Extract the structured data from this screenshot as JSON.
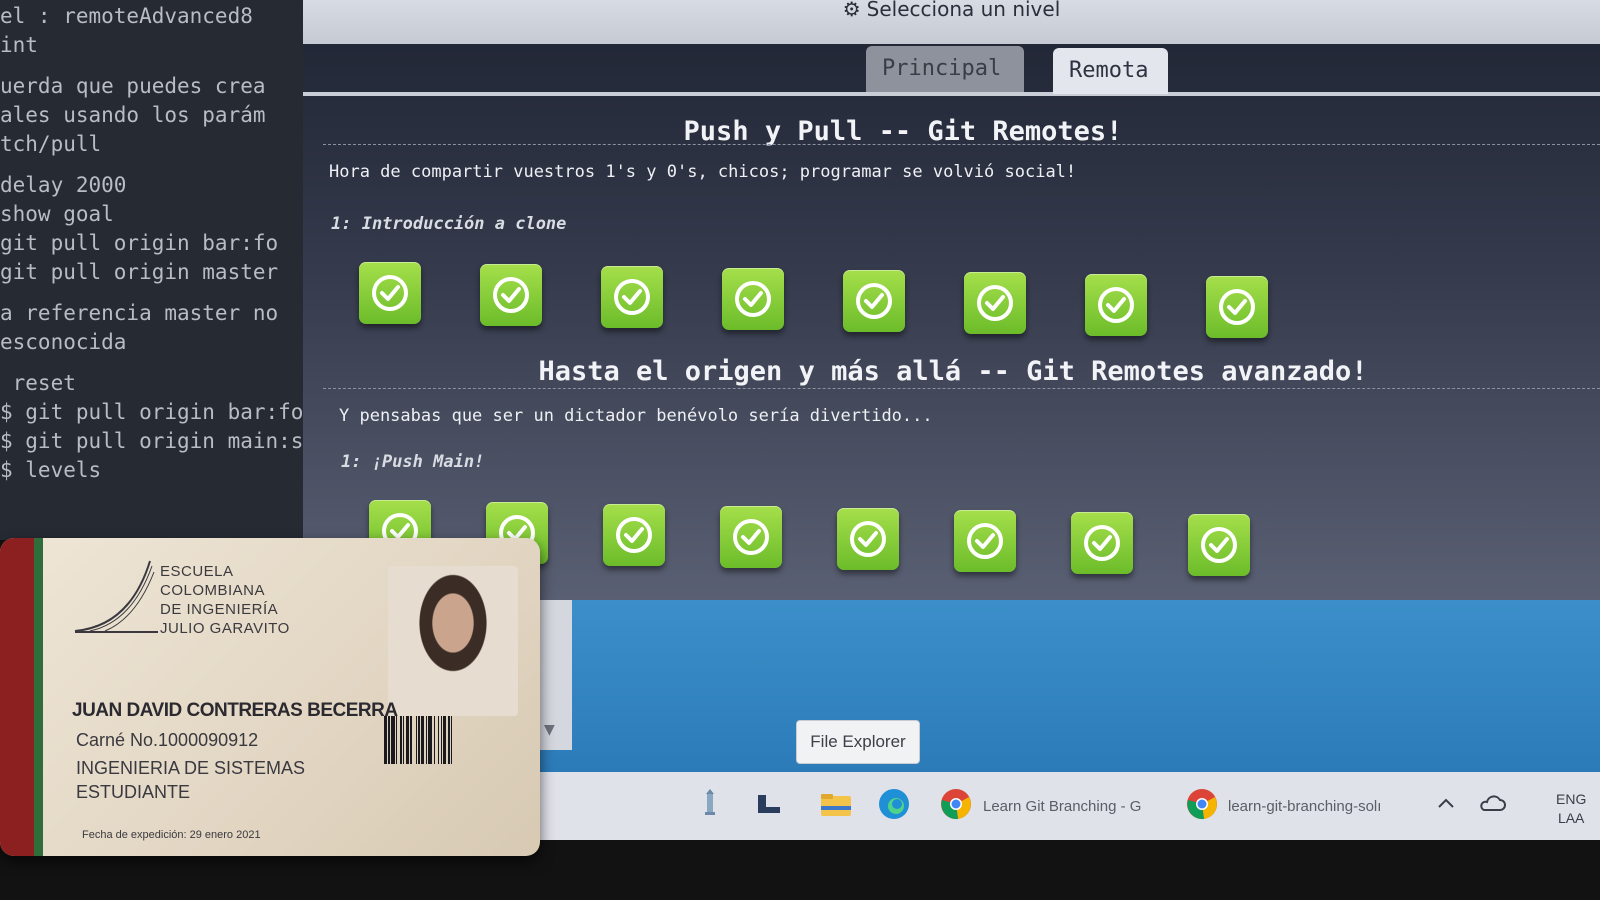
{
  "terminal": {
    "lines": [
      "el : remoteAdvanced8",
      "int",
      "",
      "uerda que puedes crea",
      "ales usando los parám",
      "tch/pull",
      "",
      "delay 2000",
      "show goal",
      "git pull origin bar:fo",
      "git pull origin master",
      "",
      "a referencia master no",
      "esconocida",
      "",
      " reset",
      "$ git pull origin bar:fo",
      "$ git pull origin main:s",
      "$ levels"
    ]
  },
  "window": {
    "title": "Selecciona un nivel",
    "gear_icon": "gear-icon"
  },
  "tabs": [
    {
      "label": "Principal",
      "active": false
    },
    {
      "label": "Remota",
      "active": true
    }
  ],
  "sections": [
    {
      "title": "Push y Pull -- Git Remotes!",
      "description": "Hora de compartir vuestros 1's y 0's, chicos; programar se volvió social!",
      "subtitle": "1: Introducción a clone",
      "levels_completed": 8
    },
    {
      "title": "Hasta el origen y más allá -- Git Remotes avanzado!",
      "description": "Y pensabas que ser un dictador benévolo sería divertido...",
      "subtitle": "1: ¡Push Main!",
      "levels_completed": 8
    }
  ],
  "tooltip": {
    "text": "File Explorer"
  },
  "taskbar": {
    "chrome_tab_1": "Learn Git Branching - G",
    "chrome_tab_2": "learn-git-branching-solı",
    "lang_1": "ENG",
    "lang_2": "LAA"
  },
  "id_card": {
    "school_lines": [
      "Escuela",
      "Colombiana",
      "de Ingeniería",
      "Julio Garavito"
    ],
    "name": "JUAN DAVID CONTRERAS BECERRA",
    "carne": "Carné No.1000090912",
    "program": "INGENIERIA DE SISTEMAS",
    "role": "ESTUDIANTE",
    "expedition": "Fecha de expedición: 29 enero 2021"
  },
  "colors": {
    "level_complete": "#7ec432",
    "panel_bg": "#2a2f3f",
    "desktop_blue": "#3388c4"
  }
}
